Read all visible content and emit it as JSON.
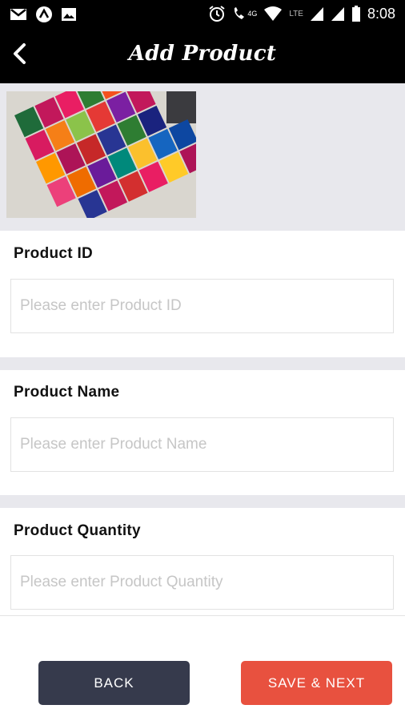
{
  "status_bar": {
    "time": "8:08",
    "network_label": "LTE",
    "network_4g": "4G",
    "icons": [
      "gmail-icon",
      "app-circle-icon",
      "image-icon",
      "alarm-icon",
      "call-icon",
      "wifi-icon",
      "signal-icon",
      "signal-icon-2",
      "battery-icon"
    ]
  },
  "header": {
    "title": "Add Product",
    "back_icon": "chevron-left-icon"
  },
  "product_image": {
    "description_icon": "product-photo"
  },
  "form": {
    "product_id": {
      "label": "Product ID",
      "placeholder": "Please enter Product ID",
      "value": ""
    },
    "product_name": {
      "label": "Product Name",
      "placeholder": "Please enter Product Name",
      "value": ""
    },
    "product_quantity": {
      "label": "Product Quantity",
      "placeholder": "Please enter Product Quantity",
      "value": ""
    }
  },
  "buttons": {
    "back_label": "BACK",
    "save_label": "SAVE & NEXT"
  },
  "colors": {
    "header_bg": "#000000",
    "strip_bg": "#e8e8ed",
    "back_button": "#363a4c",
    "save_button": "#e8513f"
  }
}
